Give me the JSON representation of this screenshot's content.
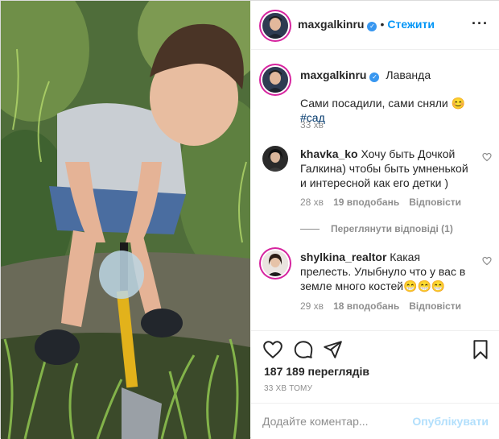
{
  "post": {
    "author": "maxgalkinru",
    "follow_label": "Стежити",
    "more_icon": "more-horizontal-icon",
    "views": "187 189 переглядів",
    "time_ago": "33 ХВ ТОМУ"
  },
  "caption": {
    "author": "maxgalkinru",
    "location": "Лаванда",
    "text": "Сами посадили, сами сняли 😊",
    "hashtag": "#сад",
    "time": "33 хв"
  },
  "comments": [
    {
      "author": "khavka_ko",
      "text": "Хочу быть Дочкой Галкина) чтобы быть умненькой и интересной как его детки )",
      "time": "28 хв",
      "likes": "19 вподобань",
      "reply": "Відповісти",
      "view_replies": "Переглянути відповіді (1)"
    },
    {
      "author": "shylkina_realtor",
      "text": "Какая прелесть. Улыбнуло что у вас в земле много костей😁😁😁",
      "time": "29 хв",
      "likes": "18 вподобань",
      "reply": "Відповісти"
    }
  ],
  "composer": {
    "placeholder": "Додайте коментар...",
    "publish_label": "Опублікувати"
  },
  "colors": {
    "accent": "#0095f6",
    "publish_disabled": "#b2dffc",
    "muted": "#8e8e8e",
    "verified": "#3897f0"
  }
}
